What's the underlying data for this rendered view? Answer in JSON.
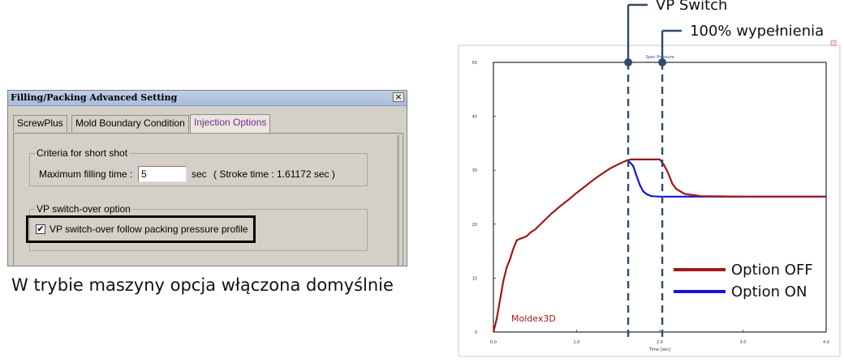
{
  "dialog": {
    "title": "Filling/Packing Advanced Setting",
    "close_glyph": "×",
    "tabs": [
      {
        "label": "ScrewPlus"
      },
      {
        "label": "Mold Boundary Condition"
      },
      {
        "label": "Injection Options"
      }
    ],
    "criteria": {
      "group_label": "Criteria for short shot",
      "field_label": "Maximum filling time :",
      "field_value": "5",
      "unit": "sec",
      "stroke_text": "( Stroke time : 1.61172 sec )"
    },
    "vp": {
      "group_label": "VP switch-over option",
      "checkbox_label": "VP switch-over follow packing pressure profile",
      "checked": true,
      "check_glyph": "✔"
    }
  },
  "caption": "W trybie maszyny opcja włączona domyślnie",
  "chart_data": {
    "type": "line",
    "title": "Spec Pressure",
    "xlabel": "Time [sec]",
    "ylabel": "",
    "xlim": [
      0,
      4.0
    ],
    "ylim": [
      0,
      50
    ],
    "xticks": [
      "0.0",
      "1.0",
      "2.0",
      "3.0",
      "4.0"
    ],
    "yticks": [
      "0",
      "10",
      "20",
      "30",
      "40",
      "50"
    ],
    "grid": false,
    "legend_position": "bottom-right",
    "series": [
      {
        "name": "Option OFF",
        "color": "#a01818",
        "x": [
          0.0,
          0.04,
          0.08,
          0.12,
          0.16,
          0.2,
          0.24,
          0.28,
          0.32,
          0.36,
          0.4,
          0.45,
          0.5,
          0.6,
          0.7,
          0.8,
          0.9,
          1.0,
          1.1,
          1.2,
          1.3,
          1.4,
          1.5,
          1.6,
          1.65,
          2.0,
          2.05,
          2.1,
          2.15,
          2.2,
          2.3,
          2.5,
          3.0,
          4.0
        ],
        "y": [
          0,
          2.5,
          6,
          9.5,
          12,
          13.5,
          15.5,
          17,
          17.3,
          17.5,
          17.8,
          18.5,
          19,
          20.5,
          22,
          23.3,
          24.5,
          25.8,
          27,
          28.2,
          29.3,
          30.3,
          31.1,
          31.8,
          32,
          32,
          31,
          29.5,
          27.5,
          26.5,
          25.6,
          25.2,
          25.1,
          25.1
        ]
      },
      {
        "name": "Option ON",
        "color": "#1515d8",
        "x": [
          1.62,
          1.68,
          1.72,
          1.76,
          1.8,
          1.85,
          1.9,
          2.0,
          2.2,
          2.5,
          3.0,
          4.0
        ],
        "y": [
          31.8,
          30.8,
          29,
          27.3,
          26.1,
          25.5,
          25.2,
          25.1,
          25.1,
          25.1,
          25.1,
          25.1
        ]
      }
    ],
    "annotations": [
      {
        "label": "VP Switch",
        "x": 1.62
      },
      {
        "label": "100% wypełnienia",
        "x": 2.03
      }
    ],
    "watermark": "Moldex3D"
  }
}
